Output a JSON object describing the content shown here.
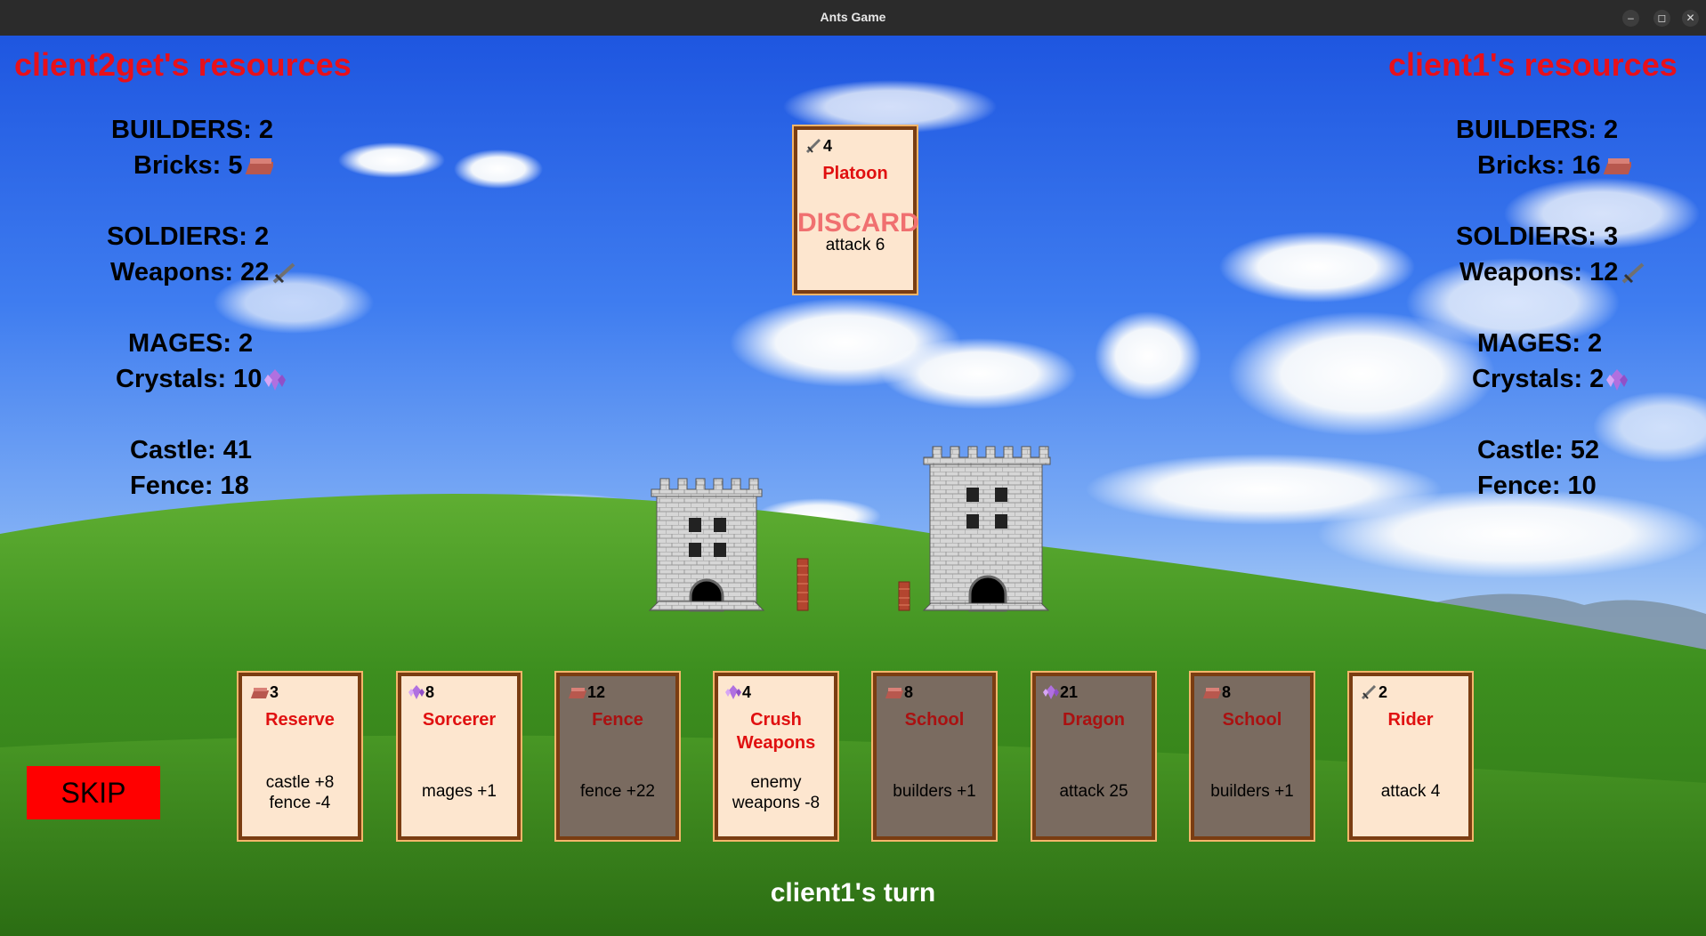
{
  "window": {
    "title": "Ants Game"
  },
  "left": {
    "title": "client2get's resources",
    "builders": "BUILDERS: 2",
    "bricks": "Bricks: 5",
    "soldiers": "SOLDIERS: 2",
    "weapons": "Weapons: 22",
    "mages": "MAGES: 2",
    "crystals": "Crystals: 10",
    "castle": "Castle: 41",
    "fence": "Fence: 18"
  },
  "right": {
    "title": "client1's resources",
    "builders": "BUILDERS: 2",
    "bricks": "Bricks: 16",
    "soldiers": "SOLDIERS: 3",
    "weapons": "Weapons: 12",
    "mages": "MAGES: 2",
    "crystals": "Crystals: 2",
    "castle": "Castle: 52",
    "fence": "Fence: 10"
  },
  "discard_card": {
    "cost": "4",
    "resource": "weapons",
    "name": "Platoon",
    "overlay": "DISCARD",
    "effect": "attack 6"
  },
  "hand": [
    {
      "cost": "3",
      "resource": "bricks",
      "name": "Reserve",
      "effect": "castle +8\nfence -4",
      "playable": true
    },
    {
      "cost": "8",
      "resource": "crystals",
      "name": "Sorcerer",
      "effect": "mages +1",
      "playable": true
    },
    {
      "cost": "12",
      "resource": "bricks",
      "name": "Fence",
      "effect": "fence +22",
      "playable": false
    },
    {
      "cost": "4",
      "resource": "crystals",
      "name": "Crush\nWeapons",
      "effect": "enemy\nweapons -8",
      "playable": true
    },
    {
      "cost": "8",
      "resource": "bricks",
      "name": "School",
      "effect": "builders +1",
      "playable": false
    },
    {
      "cost": "21",
      "resource": "crystals",
      "name": "Dragon",
      "effect": "attack 25",
      "playable": false
    },
    {
      "cost": "8",
      "resource": "bricks",
      "name": "School",
      "effect": "builders +1",
      "playable": false
    },
    {
      "cost": "2",
      "resource": "weapons",
      "name": "Rider",
      "effect": "attack 4",
      "playable": true
    }
  ],
  "controls": {
    "skip": "SKIP"
  },
  "status": {
    "turn": "client1's turn"
  },
  "colors": {
    "title_red": "#e8101a",
    "card_bg": "#fde6cf",
    "card_disabled": "#7a6b60",
    "card_border": "#7a3d12",
    "skip_bg": "#ff0000"
  }
}
